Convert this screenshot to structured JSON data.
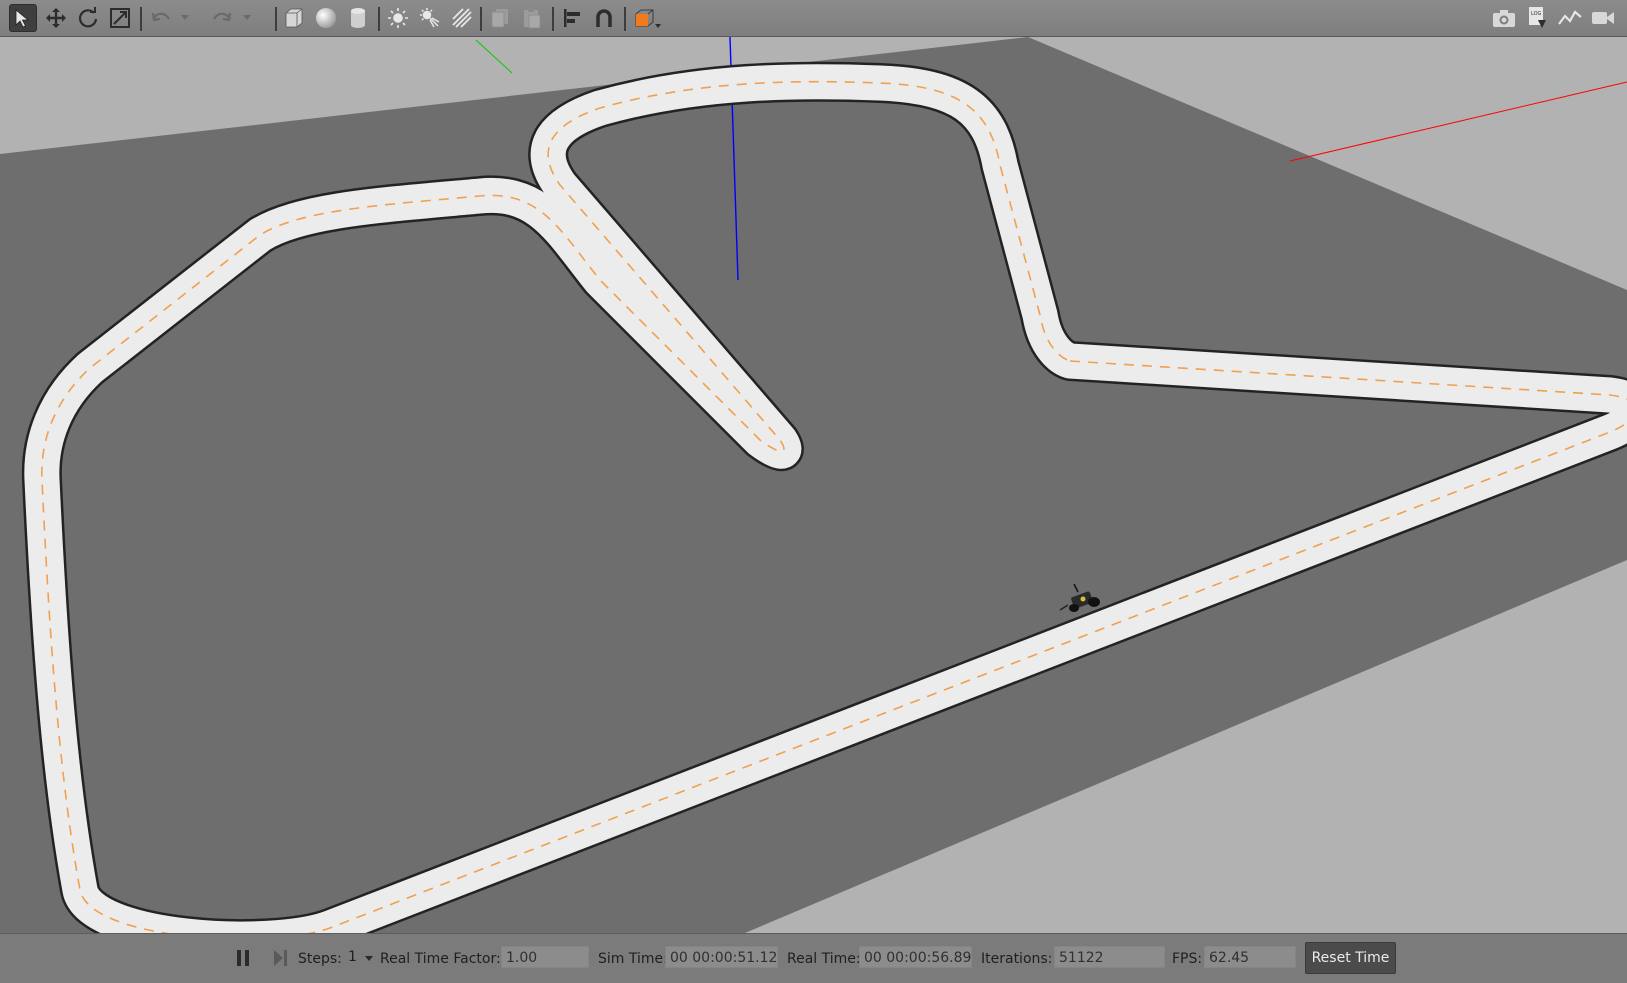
{
  "toolbar": {
    "left_tools": [
      "select-icon",
      "translate-icon",
      "rotate-icon",
      "scale-icon",
      "undo-icon",
      "undo-dropdown-icon",
      "redo-icon",
      "redo-dropdown-icon",
      "box-icon",
      "sphere-icon",
      "cylinder-icon",
      "point-light-icon",
      "spot-light-icon",
      "directional-light-icon",
      "copy-icon",
      "paste-icon",
      "align-icon",
      "snap-icon",
      "view-angle-icon"
    ],
    "right_tools": [
      "screenshot-icon",
      "log-icon",
      "plot-icon",
      "record-video-icon"
    ],
    "accent_color": "#f07a1c"
  },
  "bottombar": {
    "steps_label": "Steps:",
    "steps_value": "1",
    "rtf_label": "Real Time Factor:",
    "rtf_value": "1.00",
    "sim_time_label": "Sim Time:",
    "sim_time_value": "00 00:00:51.122",
    "real_time_label": "Real Time:",
    "real_time_value": "00 00:00:56.894",
    "iterations_label": "Iterations:",
    "iterations_value": "51122",
    "fps_label": "FPS:",
    "fps_value": "62.45",
    "reset_label": "Reset Time"
  },
  "scene": {
    "sky_color": "#b2b2b2",
    "ground_color": "#6e6e6e",
    "track_color": "#ececec",
    "center_line_color": "#f0a050",
    "x_axis_color": "#ff0000",
    "y_axis_color": "#00cc00",
    "z_axis_color": "#0000ff"
  }
}
